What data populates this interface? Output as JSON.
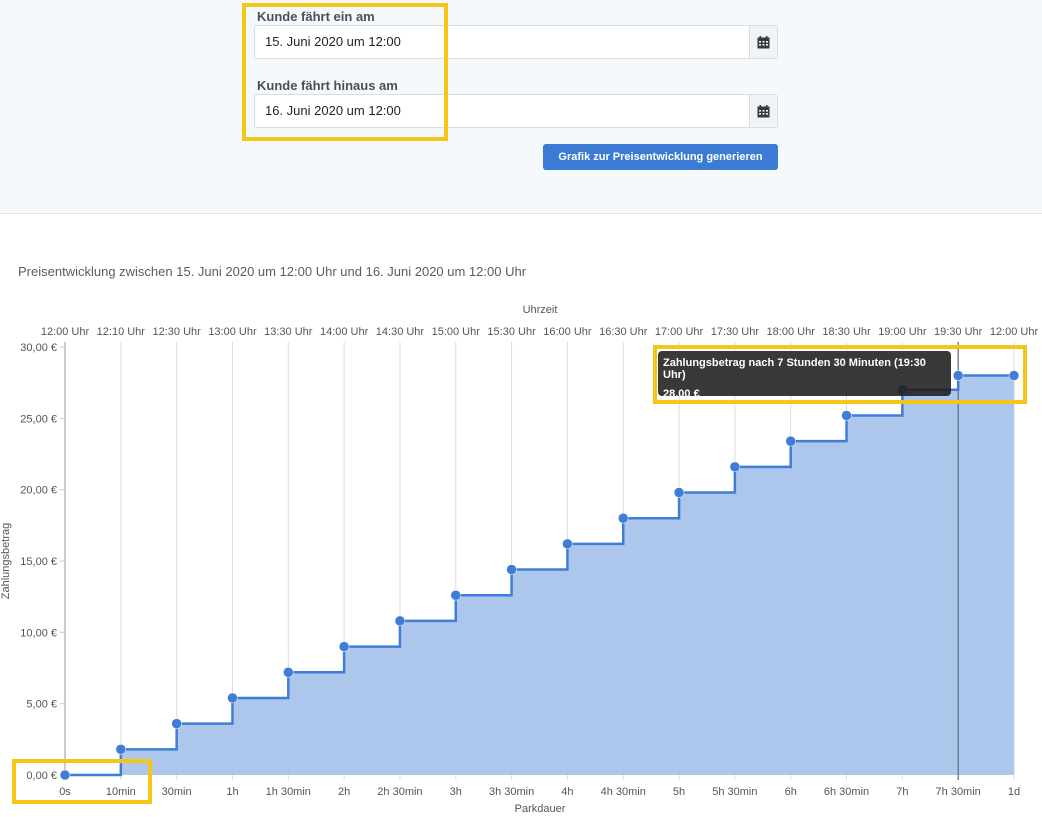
{
  "form": {
    "arrival_label": "Kunde fährt ein am",
    "arrival_value": "15. Juni 2020 um 12:00",
    "departure_label": "Kunde fährt hinaus am",
    "departure_value": "16. Juni 2020 um 12:00",
    "generate_button": "Grafik zur Preisentwicklung generieren",
    "calendar_icon": "calendar-icon"
  },
  "chart_title": "Preisentwicklung zwischen 15. Juni 2020 um 12:00 Uhr und 16. Juni 2020 um 12:00 Uhr",
  "tooltip": {
    "title": "Zahlungsbetrag nach 7 Stunden 30 Minuten (19:30 Uhr)",
    "value": "28,00 €"
  },
  "colors": {
    "line": "#3f7dd6",
    "fill": "#a9c3ea",
    "highlight": "#f5c518",
    "button": "#3b7bd4"
  },
  "chart_data": {
    "type": "area",
    "step": true,
    "title": "",
    "xlabel": "Parkdauer",
    "x2label": "Uhrzeit",
    "ylabel": "Zahlungsbetrag",
    "x_minutes": [
      0,
      10,
      30,
      60,
      90,
      120,
      150,
      180,
      210,
      240,
      270,
      300,
      330,
      360,
      390,
      420,
      450,
      1440
    ],
    "x_tick_labels": [
      "0s",
      "10min",
      "30min",
      "1h",
      "1h 30min",
      "2h",
      "2h 30min",
      "3h",
      "3h 30min",
      "4h",
      "4h 30min",
      "5h",
      "5h 30min",
      "6h",
      "6h 30min",
      "7h",
      "7h 30min",
      "1d"
    ],
    "x2_tick_labels": [
      "12:00 Uhr",
      "12:10 Uhr",
      "12:30 Uhr",
      "13:00 Uhr",
      "13:30 Uhr",
      "14:00 Uhr",
      "14:30 Uhr",
      "15:00 Uhr",
      "15:30 Uhr",
      "16:00 Uhr",
      "16:30 Uhr",
      "17:00 Uhr",
      "17:30 Uhr",
      "18:00 Uhr",
      "18:30 Uhr",
      "19:00 Uhr",
      "19:30 Uhr",
      "12:00 Uhr"
    ],
    "values": [
      0,
      1.8,
      3.6,
      5.4,
      7.2,
      9.0,
      10.8,
      12.6,
      14.4,
      16.2,
      18.0,
      19.8,
      21.6,
      23.4,
      25.2,
      27.0,
      28.0,
      28.0
    ],
    "y_ticks": [
      0,
      5,
      10,
      15,
      20,
      25,
      30
    ],
    "y_tick_labels": [
      "0,00 €",
      "5,00 €",
      "10,00 €",
      "15,00 €",
      "20,00 €",
      "25,00 €",
      "30,00 €"
    ],
    "ylim": [
      0,
      30
    ],
    "grid": true,
    "active_index": 16
  }
}
